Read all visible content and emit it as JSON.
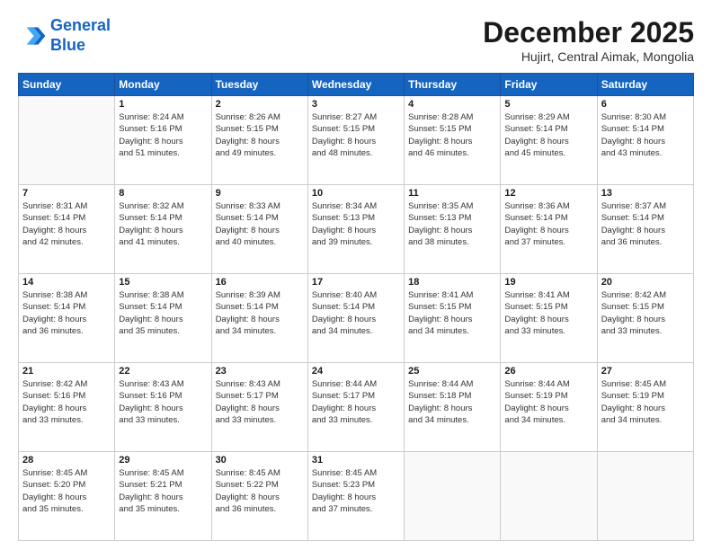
{
  "logo": {
    "line1": "General",
    "line2": "Blue"
  },
  "header": {
    "month": "December 2025",
    "location": "Hujirt, Central Aimak, Mongolia"
  },
  "weekdays": [
    "Sunday",
    "Monday",
    "Tuesday",
    "Wednesday",
    "Thursday",
    "Friday",
    "Saturday"
  ],
  "weeks": [
    [
      {
        "day": "",
        "info": ""
      },
      {
        "day": "1",
        "info": "Sunrise: 8:24 AM\nSunset: 5:16 PM\nDaylight: 8 hours\nand 51 minutes."
      },
      {
        "day": "2",
        "info": "Sunrise: 8:26 AM\nSunset: 5:15 PM\nDaylight: 8 hours\nand 49 minutes."
      },
      {
        "day": "3",
        "info": "Sunrise: 8:27 AM\nSunset: 5:15 PM\nDaylight: 8 hours\nand 48 minutes."
      },
      {
        "day": "4",
        "info": "Sunrise: 8:28 AM\nSunset: 5:15 PM\nDaylight: 8 hours\nand 46 minutes."
      },
      {
        "day": "5",
        "info": "Sunrise: 8:29 AM\nSunset: 5:14 PM\nDaylight: 8 hours\nand 45 minutes."
      },
      {
        "day": "6",
        "info": "Sunrise: 8:30 AM\nSunset: 5:14 PM\nDaylight: 8 hours\nand 43 minutes."
      }
    ],
    [
      {
        "day": "7",
        "info": "Sunrise: 8:31 AM\nSunset: 5:14 PM\nDaylight: 8 hours\nand 42 minutes."
      },
      {
        "day": "8",
        "info": "Sunrise: 8:32 AM\nSunset: 5:14 PM\nDaylight: 8 hours\nand 41 minutes."
      },
      {
        "day": "9",
        "info": "Sunrise: 8:33 AM\nSunset: 5:14 PM\nDaylight: 8 hours\nand 40 minutes."
      },
      {
        "day": "10",
        "info": "Sunrise: 8:34 AM\nSunset: 5:13 PM\nDaylight: 8 hours\nand 39 minutes."
      },
      {
        "day": "11",
        "info": "Sunrise: 8:35 AM\nSunset: 5:13 PM\nDaylight: 8 hours\nand 38 minutes."
      },
      {
        "day": "12",
        "info": "Sunrise: 8:36 AM\nSunset: 5:14 PM\nDaylight: 8 hours\nand 37 minutes."
      },
      {
        "day": "13",
        "info": "Sunrise: 8:37 AM\nSunset: 5:14 PM\nDaylight: 8 hours\nand 36 minutes."
      }
    ],
    [
      {
        "day": "14",
        "info": "Sunrise: 8:38 AM\nSunset: 5:14 PM\nDaylight: 8 hours\nand 36 minutes."
      },
      {
        "day": "15",
        "info": "Sunrise: 8:38 AM\nSunset: 5:14 PM\nDaylight: 8 hours\nand 35 minutes."
      },
      {
        "day": "16",
        "info": "Sunrise: 8:39 AM\nSunset: 5:14 PM\nDaylight: 8 hours\nand 34 minutes."
      },
      {
        "day": "17",
        "info": "Sunrise: 8:40 AM\nSunset: 5:14 PM\nDaylight: 8 hours\nand 34 minutes."
      },
      {
        "day": "18",
        "info": "Sunrise: 8:41 AM\nSunset: 5:15 PM\nDaylight: 8 hours\nand 34 minutes."
      },
      {
        "day": "19",
        "info": "Sunrise: 8:41 AM\nSunset: 5:15 PM\nDaylight: 8 hours\nand 33 minutes."
      },
      {
        "day": "20",
        "info": "Sunrise: 8:42 AM\nSunset: 5:15 PM\nDaylight: 8 hours\nand 33 minutes."
      }
    ],
    [
      {
        "day": "21",
        "info": "Sunrise: 8:42 AM\nSunset: 5:16 PM\nDaylight: 8 hours\nand 33 minutes."
      },
      {
        "day": "22",
        "info": "Sunrise: 8:43 AM\nSunset: 5:16 PM\nDaylight: 8 hours\nand 33 minutes."
      },
      {
        "day": "23",
        "info": "Sunrise: 8:43 AM\nSunset: 5:17 PM\nDaylight: 8 hours\nand 33 minutes."
      },
      {
        "day": "24",
        "info": "Sunrise: 8:44 AM\nSunset: 5:17 PM\nDaylight: 8 hours\nand 33 minutes."
      },
      {
        "day": "25",
        "info": "Sunrise: 8:44 AM\nSunset: 5:18 PM\nDaylight: 8 hours\nand 34 minutes."
      },
      {
        "day": "26",
        "info": "Sunrise: 8:44 AM\nSunset: 5:19 PM\nDaylight: 8 hours\nand 34 minutes."
      },
      {
        "day": "27",
        "info": "Sunrise: 8:45 AM\nSunset: 5:19 PM\nDaylight: 8 hours\nand 34 minutes."
      }
    ],
    [
      {
        "day": "28",
        "info": "Sunrise: 8:45 AM\nSunset: 5:20 PM\nDaylight: 8 hours\nand 35 minutes."
      },
      {
        "day": "29",
        "info": "Sunrise: 8:45 AM\nSunset: 5:21 PM\nDaylight: 8 hours\nand 35 minutes."
      },
      {
        "day": "30",
        "info": "Sunrise: 8:45 AM\nSunset: 5:22 PM\nDaylight: 8 hours\nand 36 minutes."
      },
      {
        "day": "31",
        "info": "Sunrise: 8:45 AM\nSunset: 5:23 PM\nDaylight: 8 hours\nand 37 minutes."
      },
      {
        "day": "",
        "info": ""
      },
      {
        "day": "",
        "info": ""
      },
      {
        "day": "",
        "info": ""
      }
    ]
  ]
}
